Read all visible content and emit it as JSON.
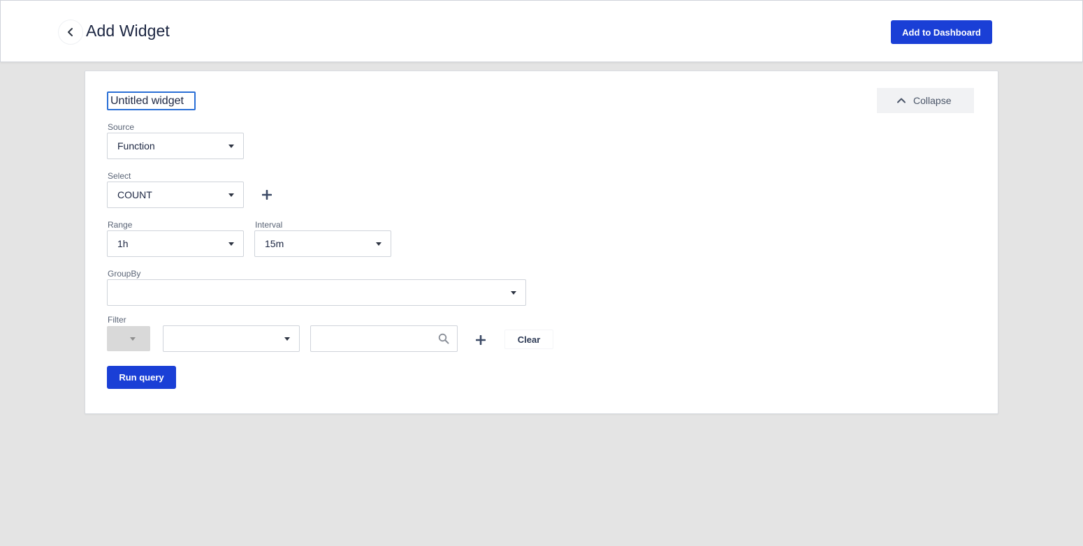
{
  "header": {
    "title": "Add Widget",
    "back_icon": "chevron-left-icon",
    "add_to_dashboard_label": "Add to Dashboard"
  },
  "widget": {
    "name": "Untitled widget",
    "collapse_label": "Collapse",
    "collapse_icon": "chevron-up-icon",
    "source": {
      "label": "Source",
      "value": "Function"
    },
    "select": {
      "label": "Select",
      "value": "COUNT"
    },
    "range": {
      "label": "Range",
      "value": "1h"
    },
    "interval": {
      "label": "Interval",
      "value": "15m"
    },
    "groupby": {
      "label": "GroupBy",
      "value": ""
    },
    "filter": {
      "label": "Filter",
      "operator_value": "",
      "field_value": "",
      "search_value": "",
      "clear_label": "Clear"
    },
    "run_query_label": "Run query"
  },
  "colors": {
    "primary": "#1a3fd6",
    "background": "#e4e4e4",
    "focus": "#2a6fd6"
  }
}
